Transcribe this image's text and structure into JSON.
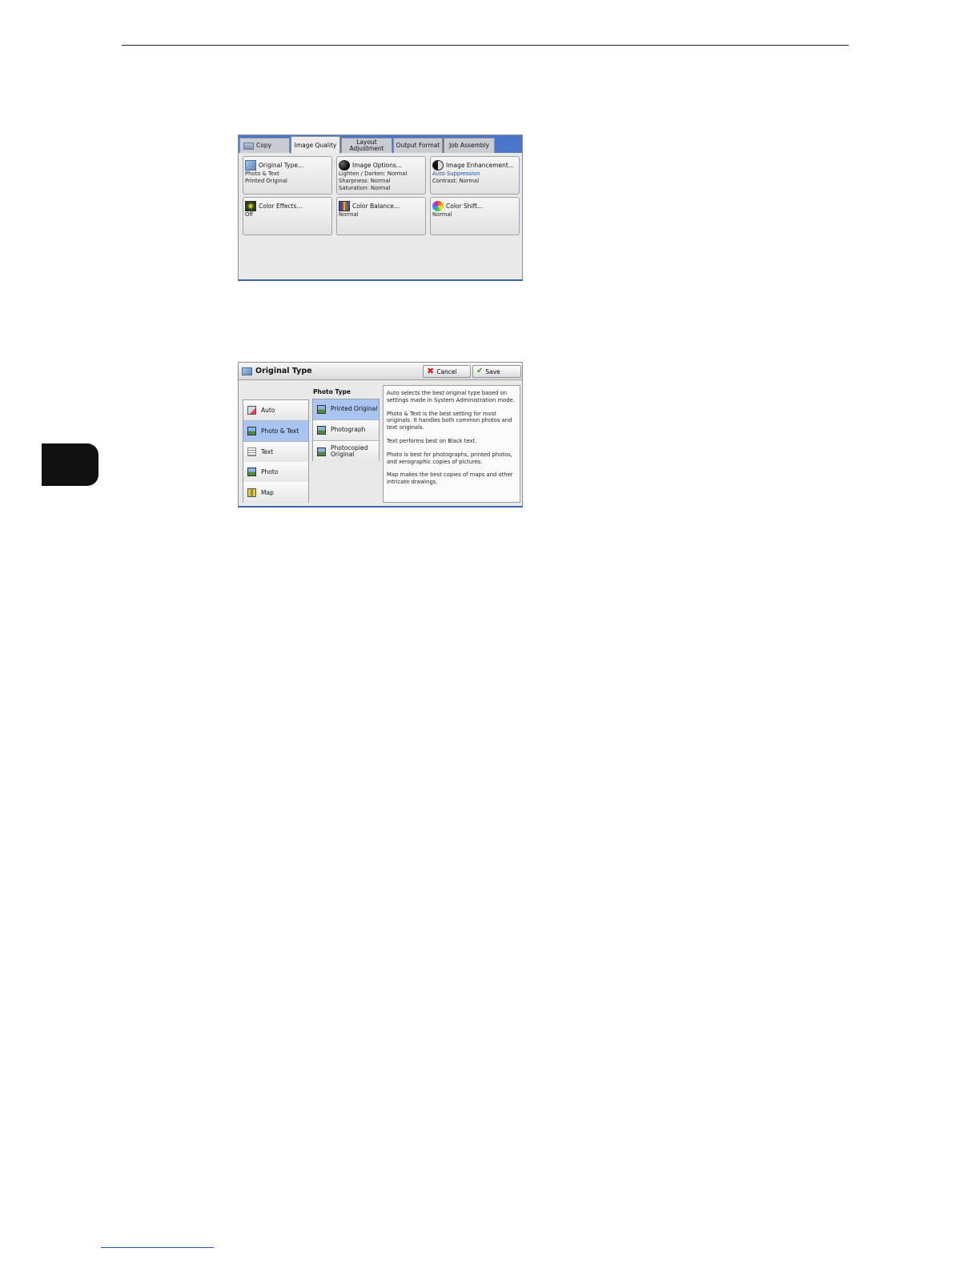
{
  "screen1": {
    "tabs": [
      {
        "label": "Copy"
      },
      {
        "label": "Image Quality"
      },
      {
        "label": "Layout Adjustment"
      },
      {
        "label": "Output Format"
      },
      {
        "label": "Job Assembly"
      }
    ],
    "features": [
      {
        "title": "Original Type...",
        "values": [
          "Photo & Text",
          "Printed Original",
          ""
        ],
        "icon": "original-type-icon"
      },
      {
        "title": "Image Options...",
        "values": [
          "Lighten / Darken: Normal",
          "Sharpness: Normal",
          "Saturation: Normal"
        ],
        "icon": "image-options-icon"
      },
      {
        "title": "Image Enhancement...",
        "values": [
          "Auto Suppression",
          "Contrast: Normal",
          ""
        ],
        "icon": "image-enhancement-icon"
      },
      {
        "title": "Color Effects...",
        "values": [
          "Off",
          "",
          ""
        ],
        "icon": "color-effects-icon"
      },
      {
        "title": "Color Balance...",
        "values": [
          "Normal",
          "",
          ""
        ],
        "icon": "color-balance-icon"
      },
      {
        "title": "Color Shift...",
        "values": [
          "Normal",
          "",
          ""
        ],
        "icon": "color-shift-icon"
      }
    ]
  },
  "screen2": {
    "title": "Original Type",
    "cancel_label": "Cancel",
    "save_label": "Save",
    "types": [
      {
        "label": "Auto"
      },
      {
        "label": "Photo & Text"
      },
      {
        "label": "Text"
      },
      {
        "label": "Photo"
      },
      {
        "label": "Map"
      }
    ],
    "selected_type": "Photo & Text",
    "photo_type_label": "Photo Type",
    "photo_types": [
      {
        "label": "Printed Original"
      },
      {
        "label": "Photograph"
      },
      {
        "label": "Photocopied Original"
      }
    ],
    "selected_photo_type": "Printed Original",
    "description": [
      "Auto selects the best original type based on settings made in System Administration mode.",
      "Photo & Text is the best setting for most originals.  It handles both common photos and text originals.",
      "Text performs best on Black text.",
      "Photo is best for photographs, printed photos, and xerographic copies of pictures.",
      "Map makes the best copies of maps and other intricate drawings."
    ]
  },
  "colors": {
    "tab_bar": "#4a76c9",
    "selected_item": "#a9c4f0",
    "highlight_text": "#1d4fb0"
  }
}
